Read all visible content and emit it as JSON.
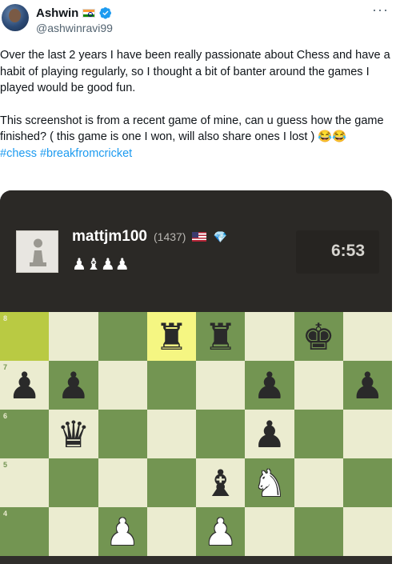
{
  "tweet": {
    "author_name": "Ashwin",
    "author_handle": "@ashwinravi99",
    "more_glyph": "···",
    "paragraphs": [
      "Over the last 2 years I have been really passionate about Chess and have a habit of playing regularly, so I thought a bit of banter around the games I played would be good fun.",
      "This screenshot is from a recent game of mine, can u guess how the game finished? ( this game is one I won, will also share ones I lost ) 😂😂"
    ],
    "hashtags": [
      "#chess",
      "#breakfromcricket"
    ]
  },
  "chess": {
    "player_name": "mattjm100",
    "player_rating": "(1437)",
    "captured_pieces": "♟♝♟♟",
    "clock": "6:53",
    "ranks": [
      "8",
      "7",
      "6",
      "5",
      "4"
    ],
    "pieces": [
      {
        "file": 3,
        "rank": 8,
        "glyph": "♜",
        "color": "black",
        "name": "black-rook-d8"
      },
      {
        "file": 4,
        "rank": 8,
        "glyph": "♜",
        "color": "black",
        "name": "black-rook-e8"
      },
      {
        "file": 6,
        "rank": 8,
        "glyph": "♚",
        "color": "black",
        "name": "black-king-g8"
      },
      {
        "file": 0,
        "rank": 7,
        "glyph": "♟",
        "color": "black",
        "name": "black-pawn-a7"
      },
      {
        "file": 1,
        "rank": 7,
        "glyph": "♟",
        "color": "black",
        "name": "black-pawn-b7"
      },
      {
        "file": 5,
        "rank": 7,
        "glyph": "♟",
        "color": "black",
        "name": "black-pawn-f7"
      },
      {
        "file": 7,
        "rank": 7,
        "glyph": "♟",
        "color": "black",
        "name": "black-pawn-h7"
      },
      {
        "file": 1,
        "rank": 6,
        "glyph": "♛",
        "color": "black",
        "name": "black-queen-b6"
      },
      {
        "file": 5,
        "rank": 6,
        "glyph": "♟",
        "color": "black",
        "name": "black-pawn-f6"
      },
      {
        "file": 4,
        "rank": 5,
        "glyph": "♝",
        "color": "black",
        "name": "black-bishop-e5"
      },
      {
        "file": 5,
        "rank": 5,
        "glyph": "♞",
        "color": "white",
        "name": "white-knight-f5"
      },
      {
        "file": 2,
        "rank": 4,
        "glyph": "♟",
        "color": "white",
        "name": "white-pawn-c4"
      },
      {
        "file": 4,
        "rank": 4,
        "glyph": "♟",
        "color": "white",
        "name": "white-pawn-e4"
      }
    ],
    "highlighted_squares": [
      {
        "file": 0,
        "rank": 8
      },
      {
        "file": 3,
        "rank": 8
      }
    ]
  }
}
